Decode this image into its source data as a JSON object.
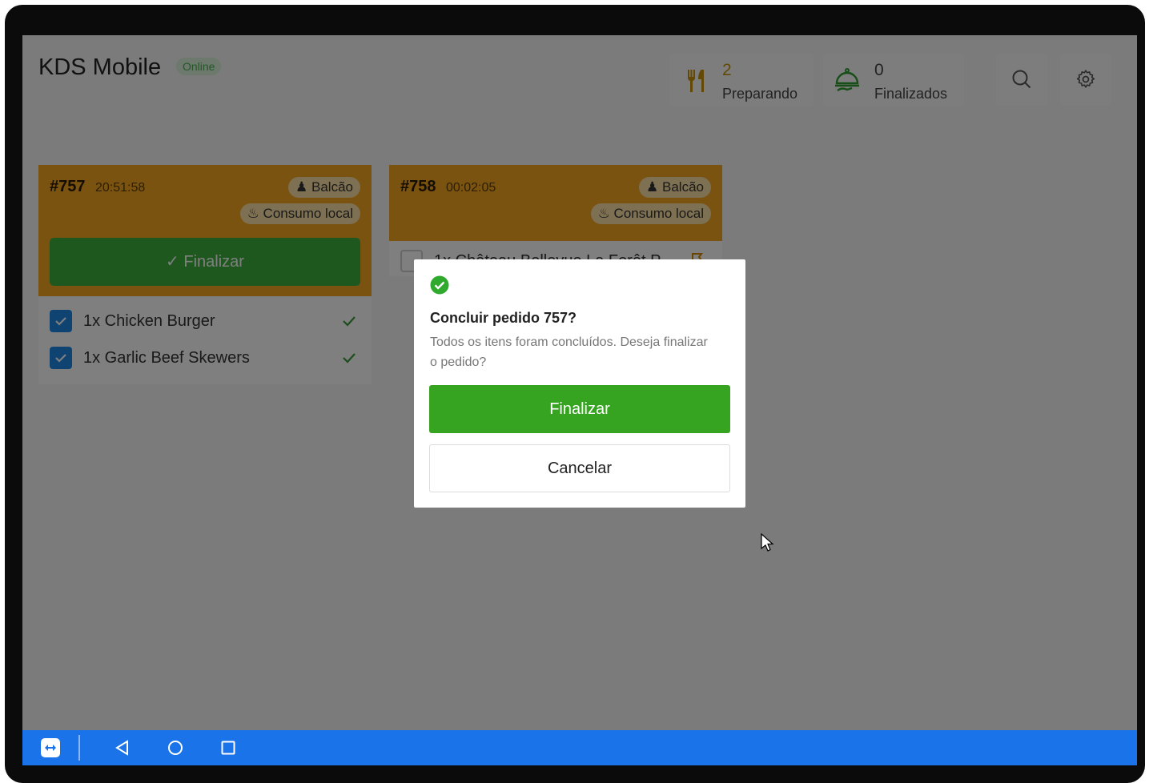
{
  "header": {
    "app_title": "KDS Mobile",
    "status": "Online",
    "stats": [
      {
        "count": "2",
        "label": "Preparando",
        "icon": "utensils-icon"
      },
      {
        "count": "0",
        "label": "Finalizados",
        "icon": "cloche-icon"
      }
    ]
  },
  "orders": [
    {
      "number": "#757",
      "time": "20:51:58",
      "tags": [
        "Balcão",
        "Consumo local"
      ],
      "finalize_label": "Finalizar",
      "items": [
        "1x Chicken Burger",
        "1x Garlic Beef Skewers"
      ]
    },
    {
      "number": "#758",
      "time": "00:02:05",
      "tags": [
        "Balcão",
        "Consumo local"
      ],
      "items": [
        "1x Château Bellevue La Forêt P..."
      ]
    }
  ],
  "dialog": {
    "title": "Concluir pedido 757?",
    "message": "Todos os itens foram concluídos. Deseja finalizar o pedido?",
    "confirm_label": "Finalizar",
    "cancel_label": "Cancelar"
  },
  "colors": {
    "order_header": "#f5a623",
    "finalize_green": "#36a420",
    "nav_blue": "#1a73e8",
    "checkbox_blue": "#1e88e5"
  }
}
